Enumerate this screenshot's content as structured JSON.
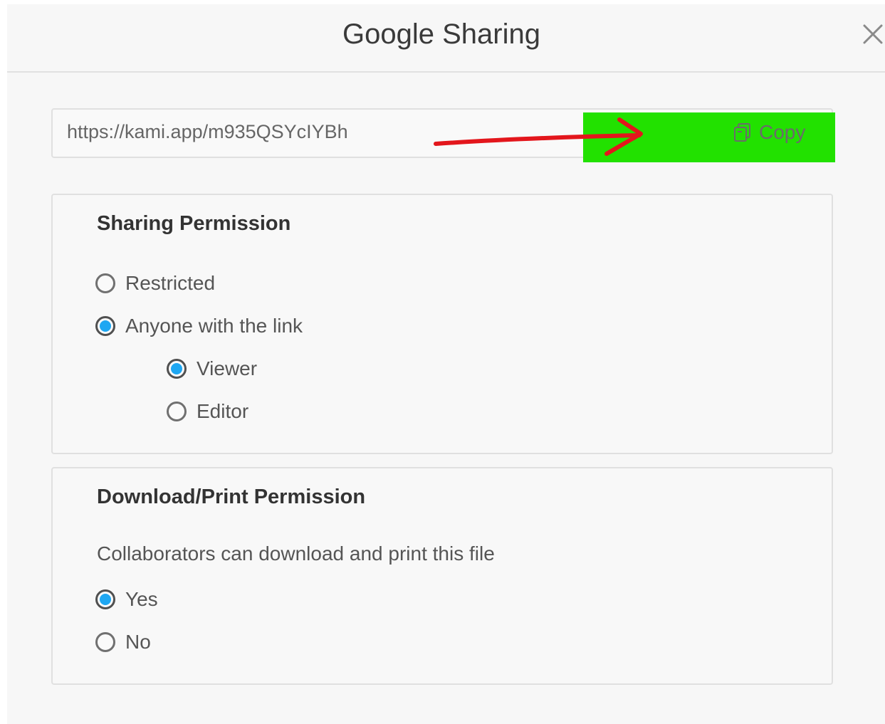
{
  "dialog": {
    "title": "Google Sharing",
    "close_icon": "close-icon"
  },
  "link": {
    "url": "https://kami.app/m935QSYcIYBh",
    "copy_label": "Copy",
    "copy_icon": "copy-icon"
  },
  "annotation": {
    "arrow_color": "#e3161c",
    "highlight_color": "#22e100"
  },
  "sharing": {
    "title": "Sharing Permission",
    "options": [
      {
        "label": "Restricted",
        "selected": false
      },
      {
        "label": "Anyone with the link",
        "selected": true
      }
    ],
    "sub_options": [
      {
        "label": "Viewer",
        "selected": true
      },
      {
        "label": "Editor",
        "selected": false
      }
    ]
  },
  "download": {
    "title": "Download/Print Permission",
    "description": "Collaborators can download and print this file",
    "options": [
      {
        "label": "Yes",
        "selected": true
      },
      {
        "label": "No",
        "selected": false
      }
    ]
  },
  "colors": {
    "radio_selected": "#1ea7f2"
  }
}
